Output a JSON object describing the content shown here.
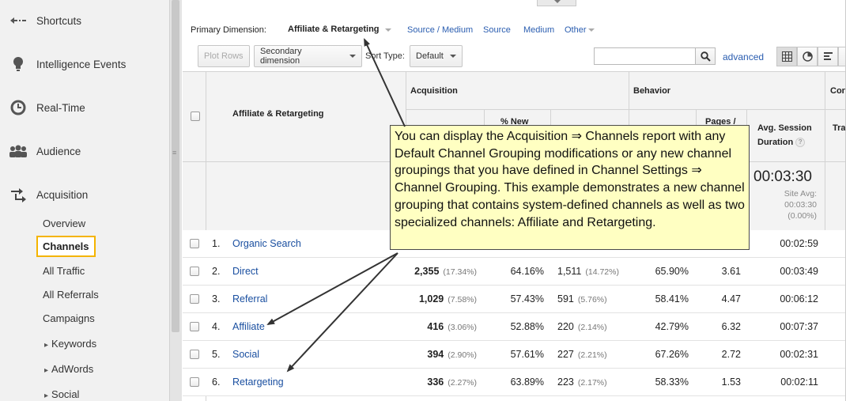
{
  "sidebar": {
    "main_items": [
      {
        "label": "Shortcuts",
        "icon": "back-arrow-icon"
      },
      {
        "label": "Intelligence Events",
        "icon": "lightbulb-icon"
      },
      {
        "label": "Real-Time",
        "icon": "clock-icon"
      },
      {
        "label": "Audience",
        "icon": "people-icon"
      },
      {
        "label": "Acquisition",
        "icon": "acquisition-arrows-icon"
      }
    ],
    "sub_items": [
      "Overview",
      "Channels",
      "All Traffic",
      "All Referrals",
      "Campaigns",
      "Keywords",
      "AdWords",
      "Social"
    ],
    "selected": "Channels",
    "highlight_color": "#f4b400"
  },
  "primary_dimension": {
    "label": "Primary Dimension:",
    "active": "Affiliate & Retargeting",
    "links": [
      "Source / Medium",
      "Source",
      "Medium",
      "Other"
    ]
  },
  "toolbar": {
    "plot_rows": "Plot Rows",
    "secondary_dimension": "Secondary dimension",
    "sort_type_label": "Sort Type:",
    "sort_type_value": "Default",
    "search_value": "",
    "advanced": "advanced"
  },
  "table": {
    "dimension_header": "Affiliate & Retargeting",
    "groups": {
      "acquisition": "Acquisition",
      "behavior": "Behavior",
      "conversions": "Con"
    },
    "columns": {
      "new_sessions_partial": "% New",
      "pages_partial": "Pages /",
      "avg_session": "Avg. Session",
      "duration": "Duration",
      "transactions_partial": "Tra"
    },
    "totals": {
      "avg_session_duration": "00:03:30",
      "site_avg_label": "Site Avg:",
      "site_avg_value": "00:03:30",
      "site_avg_delta": "(0.00%)"
    },
    "rows": [
      {
        "idx": "1.",
        "name": "Organic Search",
        "sessions": "",
        "sessions_pct": "",
        "new_pct": "",
        "new_users": "",
        "new_users_pct": "",
        "bounce": "",
        "pages": "",
        "duration": "00:02:59"
      },
      {
        "idx": "2.",
        "name": "Direct",
        "sessions": "2,355",
        "sessions_pct": "(17.34%)",
        "new_pct": "64.16%",
        "new_users": "1,511",
        "new_users_pct": "(14.72%)",
        "bounce": "65.90%",
        "pages": "3.61",
        "duration": "00:03:49"
      },
      {
        "idx": "3.",
        "name": "Referral",
        "sessions": "1,029",
        "sessions_pct": "(7.58%)",
        "new_pct": "57.43%",
        "new_users": "591",
        "new_users_pct": "(5.76%)",
        "bounce": "58.41%",
        "pages": "4.47",
        "duration": "00:06:12"
      },
      {
        "idx": "4.",
        "name": "Affiliate",
        "sessions": "416",
        "sessions_pct": "(3.06%)",
        "new_pct": "52.88%",
        "new_users": "220",
        "new_users_pct": "(2.14%)",
        "bounce": "42.79%",
        "pages": "6.32",
        "duration": "00:07:37"
      },
      {
        "idx": "5.",
        "name": "Social",
        "sessions": "394",
        "sessions_pct": "(2.90%)",
        "new_pct": "57.61%",
        "new_users": "227",
        "new_users_pct": "(2.21%)",
        "bounce": "67.26%",
        "pages": "2.72",
        "duration": "00:02:31"
      },
      {
        "idx": "6.",
        "name": "Retargeting",
        "sessions": "336",
        "sessions_pct": "(2.27%)",
        "new_pct": "63.89%",
        "new_users": "223",
        "new_users_pct": "(2.17%)",
        "bounce": "58.33%",
        "pages": "1.53",
        "duration": "00:02:11"
      }
    ]
  },
  "callout": {
    "text": "You can display the Acquisition ⇒ Channels report with any Default Channel Grouping modifications or any new channel groupings that you have defined in Channel Settings ⇒ Channel Grouping. This example demonstrates a new channel grouping that contains system-defined channels as well as two specialized channels: Affiliate and Retargeting.",
    "background": "#ffffc2"
  }
}
